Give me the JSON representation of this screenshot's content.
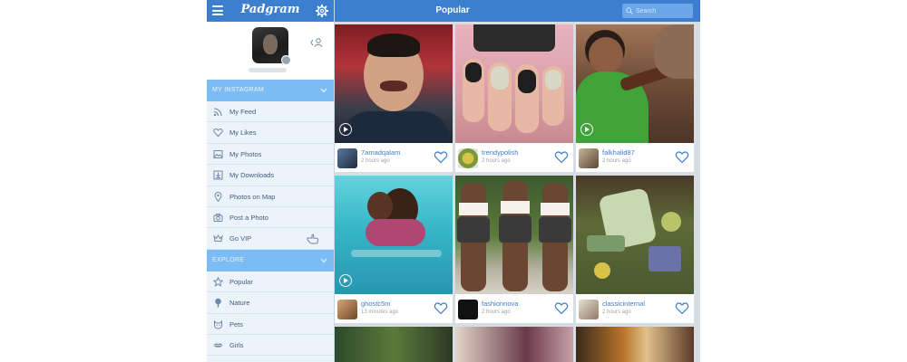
{
  "app": {
    "brand": "Padgram",
    "page_title": "Popular"
  },
  "search": {
    "placeholder": "Search"
  },
  "sidebar": {
    "sections": [
      {
        "label": "MY INSTAGRAM",
        "items": [
          {
            "label": "My Feed",
            "icon": "rss-icon"
          },
          {
            "label": "My Likes",
            "icon": "heart-icon"
          },
          {
            "label": "My Photos",
            "icon": "image-icon"
          },
          {
            "label": "My Downloads",
            "icon": "download-icon"
          },
          {
            "label": "Photos on Map",
            "icon": "map-pin-icon"
          },
          {
            "label": "Post a Photo",
            "icon": "camera-icon"
          },
          {
            "label": "Go VIP",
            "icon": "crown-icon"
          }
        ]
      },
      {
        "label": "EXPLORE",
        "items": [
          {
            "label": "Popular",
            "icon": "star-icon"
          },
          {
            "label": "Nature",
            "icon": "tree-icon"
          },
          {
            "label": "Pets",
            "icon": "cat-icon"
          },
          {
            "label": "Girls",
            "icon": "lips-icon"
          }
        ]
      }
    ]
  },
  "feed": [
    {
      "user": "7amadqalam",
      "time": "2 hours ago",
      "video": true
    },
    {
      "user": "trendypolish",
      "time": "2 hours ago",
      "video": false
    },
    {
      "user": "falkhalid87",
      "time": "2 hours ago",
      "video": true
    },
    {
      "user": "ghostc5m",
      "time": "13 minutes ago",
      "video": true
    },
    {
      "user": "fashionnova",
      "time": "2 hours ago",
      "video": false
    },
    {
      "user": "classicinternal",
      "time": "2 hours ago",
      "video": false
    }
  ],
  "colors": {
    "accent": "#3d7fcf",
    "section_header": "#7cbcf4",
    "sidebar_bg": "#ecf3fb"
  }
}
